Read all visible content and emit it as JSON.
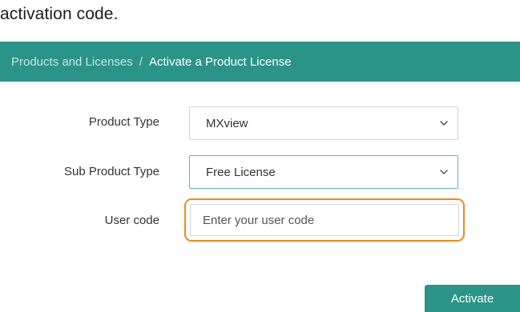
{
  "intro": {
    "text": "activation code."
  },
  "breadcrumb": {
    "parent": "Products and Licenses",
    "separator": "/",
    "current": "Activate a Product License"
  },
  "form": {
    "product_type": {
      "label": "Product Type",
      "value": "MXview"
    },
    "sub_product_type": {
      "label": "Sub Product Type",
      "value": "Free License"
    },
    "user_code": {
      "label": "User code",
      "value": "",
      "placeholder": "Enter your user code"
    }
  },
  "actions": {
    "activate_label": "Activate"
  },
  "icons": {
    "select_arrow": "chevron-down-icon"
  },
  "colors": {
    "header": "#2a9488",
    "highlight": "#f0891e",
    "focus_border": "#5fb8ae",
    "button": "#2a9488"
  }
}
